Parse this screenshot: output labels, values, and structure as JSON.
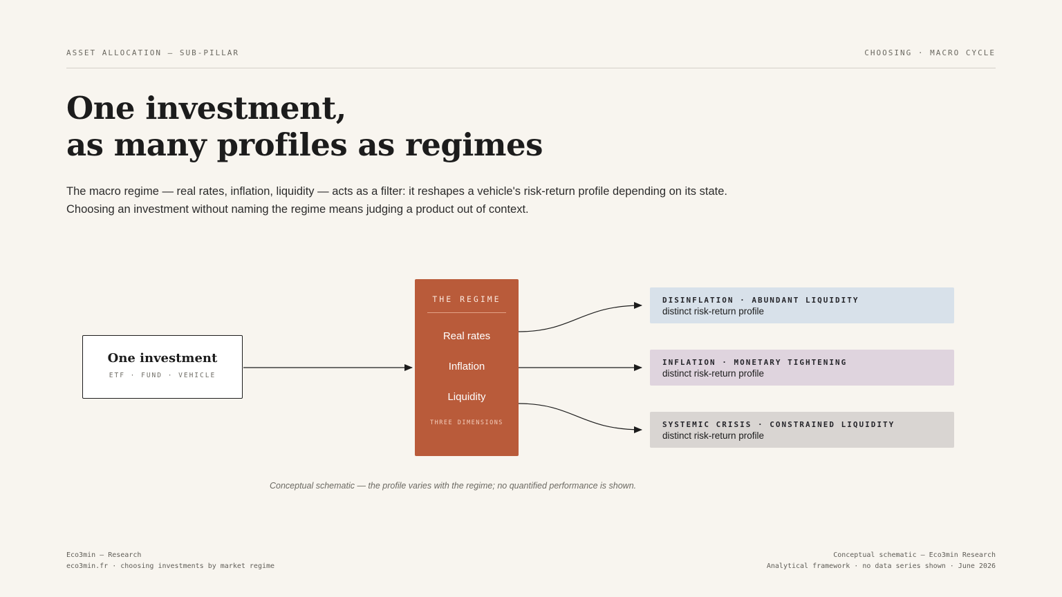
{
  "header": {
    "kicker_left": "ASSET ALLOCATION — SUB-PILLAR",
    "kicker_right": "CHOOSING · MACRO CYCLE"
  },
  "title": {
    "line1": "One investment,",
    "line2": "as many profiles as regimes"
  },
  "lede": {
    "line1": "The macro regime — real rates, inflation, liquidity — acts as a filter: it reshapes a vehicle's risk-return profile depending on its state.",
    "line2": "Choosing an investment without naming the regime means judging a product out of context."
  },
  "diagram": {
    "investment": {
      "title": "One investment",
      "subtitle": "ETF · FUND · VEHICLE"
    },
    "regime": {
      "heading": "THE REGIME",
      "items": [
        "Real rates",
        "Inflation",
        "Liquidity"
      ],
      "footer": "THREE DIMENSIONS"
    },
    "profiles": [
      {
        "heading": "DISINFLATION · ABUNDANT LIQUIDITY",
        "description": "distinct risk-return profile",
        "color": "#d8e1ea"
      },
      {
        "heading": "INFLATION · MONETARY TIGHTENING",
        "description": "distinct risk-return profile",
        "color": "#dfd4de"
      },
      {
        "heading": "SYSTEMIC CRISIS · CONSTRAINED LIQUIDITY",
        "description": "distinct risk-return profile",
        "color": "#d9d5d2"
      }
    ],
    "caption": "Conceptual schematic — the profile varies with the regime; no quantified performance is shown."
  },
  "colors": {
    "background": "#f8f5ef",
    "regime_accent": "#b95b3a",
    "ink": "#1c1c1c"
  },
  "footer": {
    "left_line1": "Eco3min — Research",
    "left_line2": "eco3min.fr · choosing investments by market regime",
    "right_line1": "Conceptual schematic — Eco3min Research",
    "right_line2": "Analytical framework · no data series shown · June 2026"
  }
}
